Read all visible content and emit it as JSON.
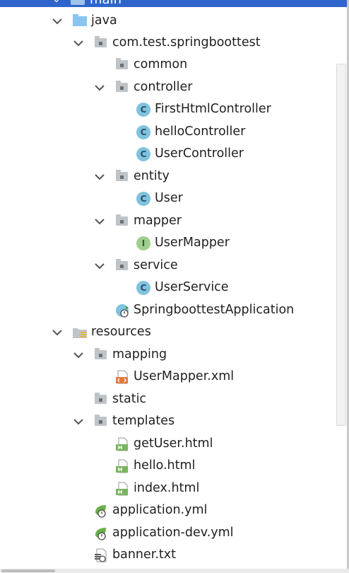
{
  "header": {
    "partial_label": "main"
  },
  "tree": [
    {
      "label": "java",
      "icon": "java-source-folder-icon",
      "expanded": true
    },
    {
      "label": "com.test.springboottest",
      "icon": "package-icon",
      "expanded": true
    },
    {
      "label": "common",
      "icon": "package-icon",
      "expanded": false
    },
    {
      "label": "controller",
      "icon": "package-icon",
      "expanded": true
    },
    {
      "label": "FirstHtmlController",
      "icon": "class-icon"
    },
    {
      "label": "helloController",
      "icon": "class-icon"
    },
    {
      "label": "UserController",
      "icon": "class-icon"
    },
    {
      "label": "entity",
      "icon": "package-icon",
      "expanded": true
    },
    {
      "label": "User",
      "icon": "class-icon"
    },
    {
      "label": "mapper",
      "icon": "package-icon",
      "expanded": true
    },
    {
      "label": "UserMapper",
      "icon": "interface-icon"
    },
    {
      "label": "service",
      "icon": "package-icon",
      "expanded": true
    },
    {
      "label": "UserService",
      "icon": "class-icon"
    },
    {
      "label": "SpringboottestApplication",
      "icon": "spring-boot-app-icon"
    },
    {
      "label": "resources",
      "icon": "resources-folder-icon",
      "expanded": true
    },
    {
      "label": "mapping",
      "icon": "package-icon",
      "expanded": true
    },
    {
      "label": "UserMapper.xml",
      "icon": "xml-file-icon"
    },
    {
      "label": "static",
      "icon": "package-icon",
      "expanded": false
    },
    {
      "label": "templates",
      "icon": "package-icon",
      "expanded": true
    },
    {
      "label": "getUser.html",
      "icon": "html-file-icon"
    },
    {
      "label": "hello.html",
      "icon": "html-file-icon"
    },
    {
      "label": "index.html",
      "icon": "html-file-icon"
    },
    {
      "label": "application.yml",
      "icon": "spring-config-icon"
    },
    {
      "label": "application-dev.yml",
      "icon": "spring-config-icon"
    },
    {
      "label": "banner.txt",
      "icon": "text-file-icon"
    }
  ],
  "glyphs": {
    "class": "C",
    "interface": "I"
  },
  "colors": {
    "selection": "#2f65ca",
    "class_icon": "#7fc3de",
    "interface_icon": "#9fcf8f",
    "package_icon": "#bfc4c9",
    "source_folder": "#87c6ef"
  }
}
